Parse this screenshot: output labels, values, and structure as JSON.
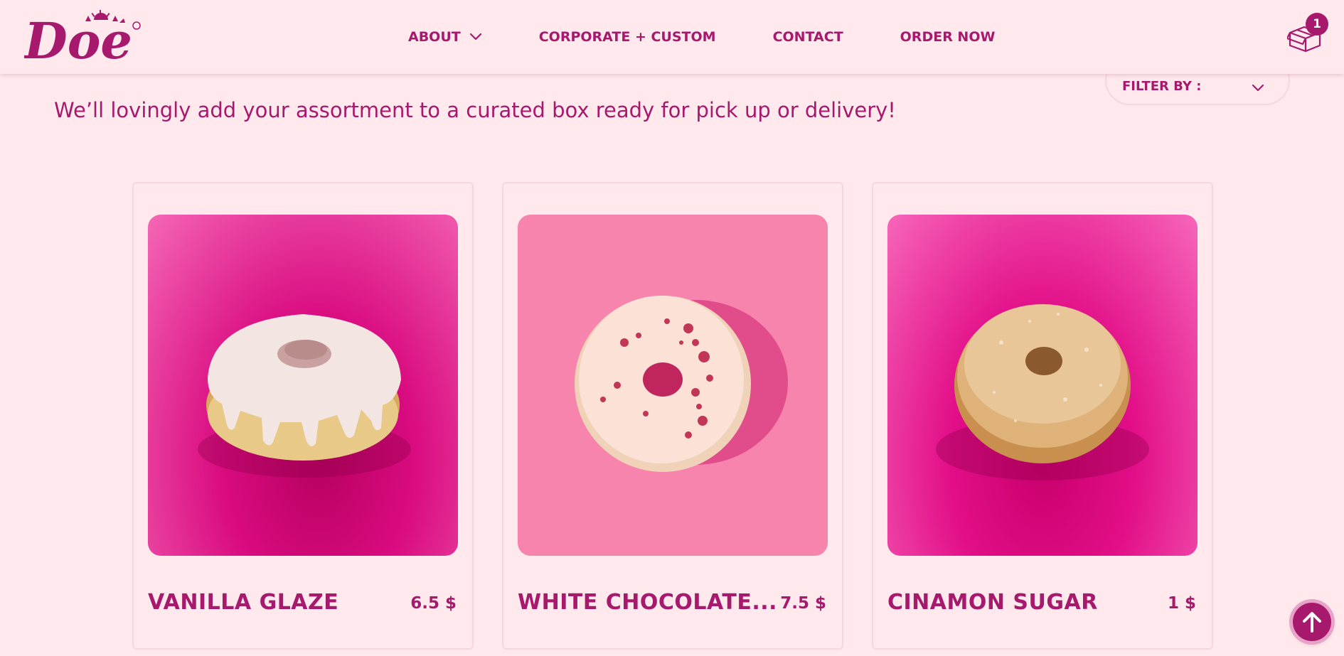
{
  "brand": {
    "logo_text": "Doe",
    "registered_mark": "®"
  },
  "nav": {
    "items": [
      {
        "label": "ABOUT",
        "has_dropdown": true
      },
      {
        "label": "CORPORATE + CUSTOM"
      },
      {
        "label": "CONTACT"
      },
      {
        "label": "ORDER NOW"
      }
    ]
  },
  "cart": {
    "icon": "box-icon",
    "count": "1"
  },
  "filter": {
    "label": "FILTER BY :",
    "icon": "chevron-down-icon"
  },
  "intro_text": "We’ll lovingly add your assortment to a curated box ready for pick up or delivery!",
  "products": [
    {
      "name": "VANILLA GLAZE",
      "price": "6.5 $",
      "image": "vanilla-glaze-donut"
    },
    {
      "name": "WHITE CHOCOLATE...",
      "price": "7.5 $",
      "image": "white-chocolate-raspberry-donut"
    },
    {
      "name": "CINAMON SUGAR",
      "price": "1 $",
      "image": "cinnamon-sugar-donut"
    }
  ],
  "scroll_top": {
    "icon": "arrow-up-icon"
  },
  "colors": {
    "brand": "#a6196d",
    "background": "#ffe9ec",
    "card_border": "#f6d7df",
    "accent_pink": "#e20e88"
  }
}
